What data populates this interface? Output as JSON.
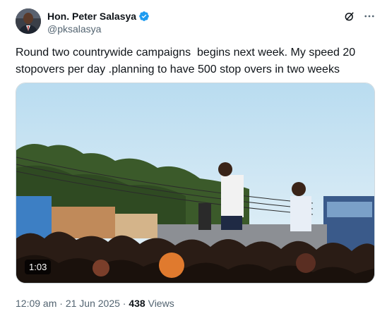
{
  "author": {
    "display_name": "Hon. Peter Salasya",
    "handle": "@pksalasya",
    "avatar_icon": "avatar-portrait",
    "verified_icon": "verified-badge-icon",
    "verified_color": "#1d9bf0"
  },
  "header_actions": {
    "grok_icon": "grok-icon",
    "more_icon": "more-icon"
  },
  "tweet": {
    "text": "Round two countrywide campaigns  begins next week. My speed 20 stopovers per day .planning to have 500 stop overs in two weeks"
  },
  "media": {
    "type": "video",
    "duration": "1:03"
  },
  "meta": {
    "time": "12:09 am",
    "separator": " · ",
    "date": "21 Jun 2025",
    "separator2": " · ",
    "views_count": "438",
    "views_label": " Views"
  },
  "colors": {
    "text_primary": "#0f1419",
    "text_secondary": "#536471",
    "border": "#cfd9de"
  }
}
